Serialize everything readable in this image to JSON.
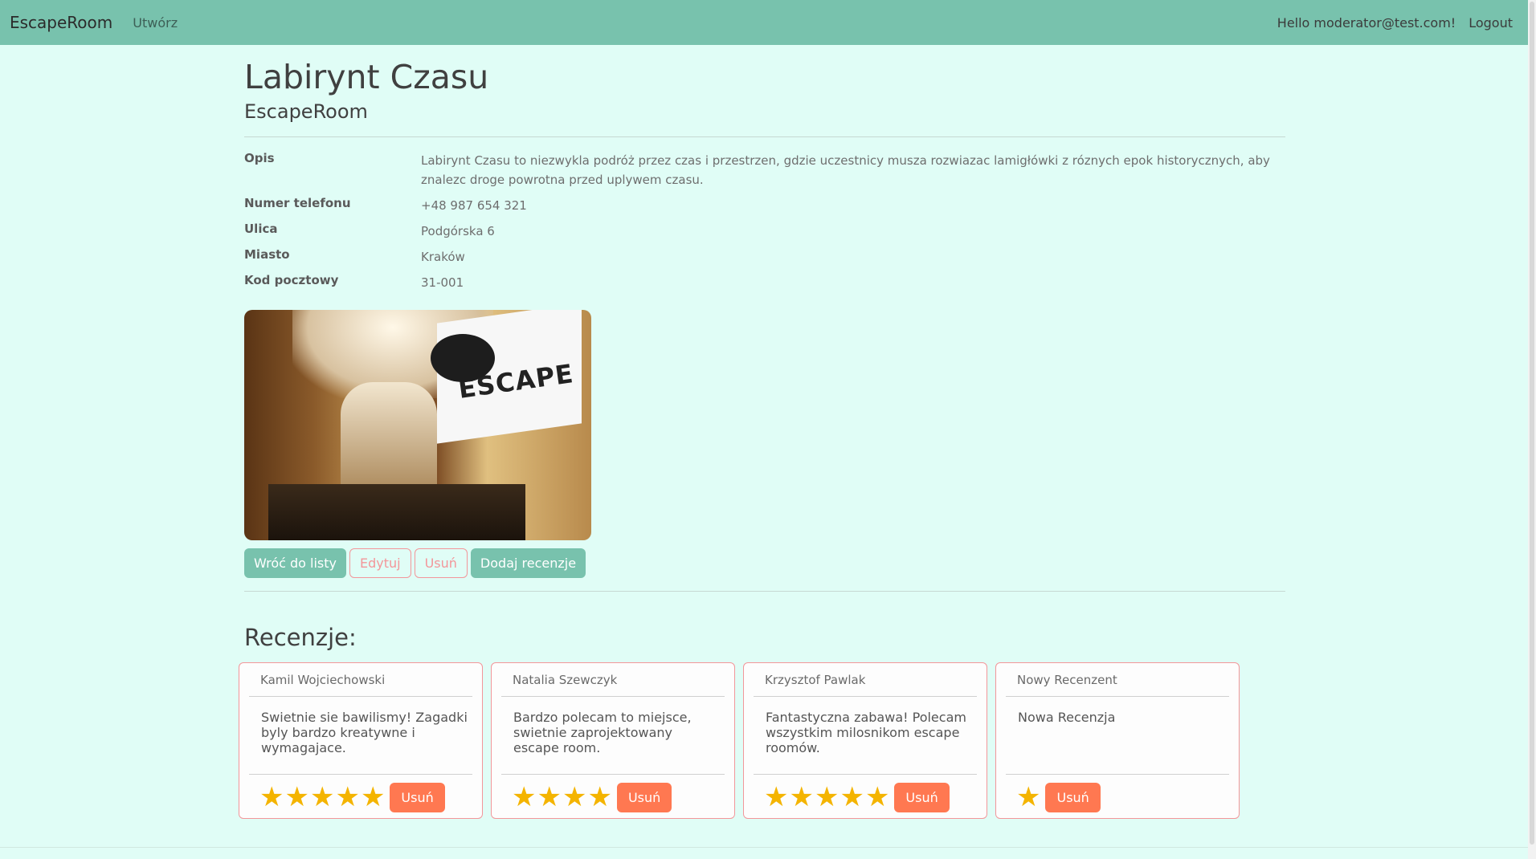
{
  "nav": {
    "brand": "EscapeRoom",
    "create_link": "Utwórz",
    "greeting": "Hello moderator@test.com!",
    "logout": "Logout"
  },
  "room": {
    "title": "Labirynt Czasu",
    "subtitle": "EscapeRoom",
    "details": [
      {
        "label": "Opis",
        "value": "Labirynt Czasu to niezwykla podróż przez czas i przestrzen, gdzie uczestnicy musza rozwiazac lamigłówki z róznych epok historycznych, aby znalezc droge powrotna przed uplywem czasu."
      },
      {
        "label": "Numer telefonu",
        "value": "+48 987 654 321"
      },
      {
        "label": "Ulica",
        "value": "Podgórska 6"
      },
      {
        "label": "Miasto",
        "value": "Kraków"
      },
      {
        "label": "Kod pocztowy",
        "value": "31-001"
      }
    ],
    "image_sign_text": "ESCAPE"
  },
  "actions": {
    "back": "Wróć do listy",
    "edit": "Edytuj",
    "delete": "Usuń",
    "add_review": "Dodaj recenzje"
  },
  "reviews_title": "Recenzje:",
  "reviews": [
    {
      "author": "Kamil Wojciechowski",
      "text": "Swietnie sie bawilismy! Zagadki byly bardzo kreatywne i wymagajace.",
      "rating": 5,
      "delete": "Usuń"
    },
    {
      "author": "Natalia Szewczyk",
      "text": "Bardzo polecam to miejsce, swietnie zaprojektowany escape room.",
      "rating": 4,
      "delete": "Usuń"
    },
    {
      "author": "Krzysztof Pawlak",
      "text": "Fantastyczna zabawa! Polecam wszystkim milosnikom escape roomów.",
      "rating": 5,
      "delete": "Usuń"
    },
    {
      "author": "Nowy Recenzent",
      "text": "Nowa Recenzja",
      "rating": 1,
      "delete": "Usuń"
    }
  ],
  "colors": {
    "navbar": "#78c2ad",
    "background": "#e0fdf6",
    "primary": "#78c2ad",
    "danger": "#ff7851",
    "outline_danger": "#f3969a",
    "star": "#f4b400"
  }
}
